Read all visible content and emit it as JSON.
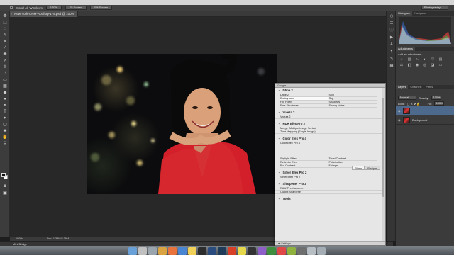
{
  "options_bar": {
    "scroll_all_label": "Scroll All Windows",
    "buttons": [
      "100%",
      "Fit Screen",
      "Fill Screen"
    ],
    "workspace": "Photography"
  },
  "document": {
    "tab_title": "New-York-OHM-Rooftop-175.psd @ 100% (Layer 1, RGB/8)"
  },
  "status": {
    "zoom": "100%",
    "doc_info": "Doc: 1.39M/2.39M"
  },
  "mini_bridge": "Mini Bridge",
  "panels": {
    "top_tabs": [
      "Histogram",
      "Navigator"
    ],
    "adjustments_tab": "Adjustments",
    "add_adjustment": "Add an adjustment",
    "layer_tabs": [
      "Layers",
      "Channels",
      "Paths"
    ],
    "blend_mode": "Normal",
    "opacity_label": "Opacity:",
    "opacity_value": "100%",
    "lock_label": "Lock:",
    "fill_label": "Fill:",
    "fill_value": "100%",
    "layers": [
      {
        "name": "",
        "active": true
      },
      {
        "name": "Background",
        "active": false
      }
    ]
  },
  "nik": {
    "title": "Google",
    "sections": [
      {
        "name": "Dfine 2",
        "type": "grid",
        "items": [
          [
            "Dfine 2",
            "Skin"
          ],
          [
            "Background",
            "Sky"
          ],
          [
            "Hot Pixels",
            "Shadows"
          ],
          [
            "Fine Structures",
            "Strong Noise"
          ]
        ]
      },
      {
        "name": "Viveza 2",
        "type": "list",
        "items": [
          "Viveza 2"
        ]
      },
      {
        "name": "HDR Efex Pro 2",
        "type": "list",
        "items": [
          "Merge (Multiple Image Series)",
          "Tone Mapping (Single Image)"
        ]
      },
      {
        "name": "Color Efex Pro 4",
        "type": "list",
        "items": [
          "Color Efex Pro 4"
        ]
      },
      {
        "name": "",
        "type": "grid",
        "items": [
          [
            "Skylight Filter",
            "Tonal Contrast"
          ],
          [
            "Reflector Efex",
            "Polarization"
          ],
          [
            "Pro Contrast",
            "Foliage"
          ]
        ]
      },
      {
        "name": "Silver Efex Pro 2",
        "type": "list",
        "items": [
          "Silver Efex Pro 2"
        ]
      },
      {
        "name": "Sharpener Pro 3",
        "type": "list",
        "items": [
          "RAW Presharpener",
          "Output Sharpener"
        ]
      },
      {
        "name": "Tools",
        "type": "list",
        "items": []
      }
    ],
    "filter_tabs": [
      "Filters",
      "Recipes"
    ],
    "settings": "Settings"
  }
}
